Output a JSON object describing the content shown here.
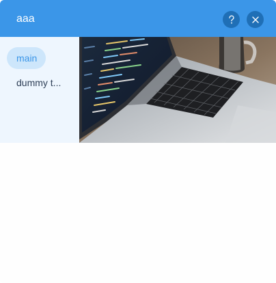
{
  "window": {
    "title": "aaa"
  },
  "header": {
    "help_icon": "question-mark-icon",
    "close_icon": "close-icon"
  },
  "sidebar": {
    "items": [
      {
        "label": "main",
        "active": true
      },
      {
        "label": "dummy t...",
        "active": false
      }
    ]
  },
  "media": {
    "description_icon": "laptop-code-photo"
  },
  "colors": {
    "header_bg": "#3b96e8",
    "button_bg": "#1f6fb6",
    "sidebar_bg": "#eef6fe",
    "active_pill_bg": "#cde6fb",
    "active_text": "#3b96e8",
    "text": "#2e3f57"
  }
}
